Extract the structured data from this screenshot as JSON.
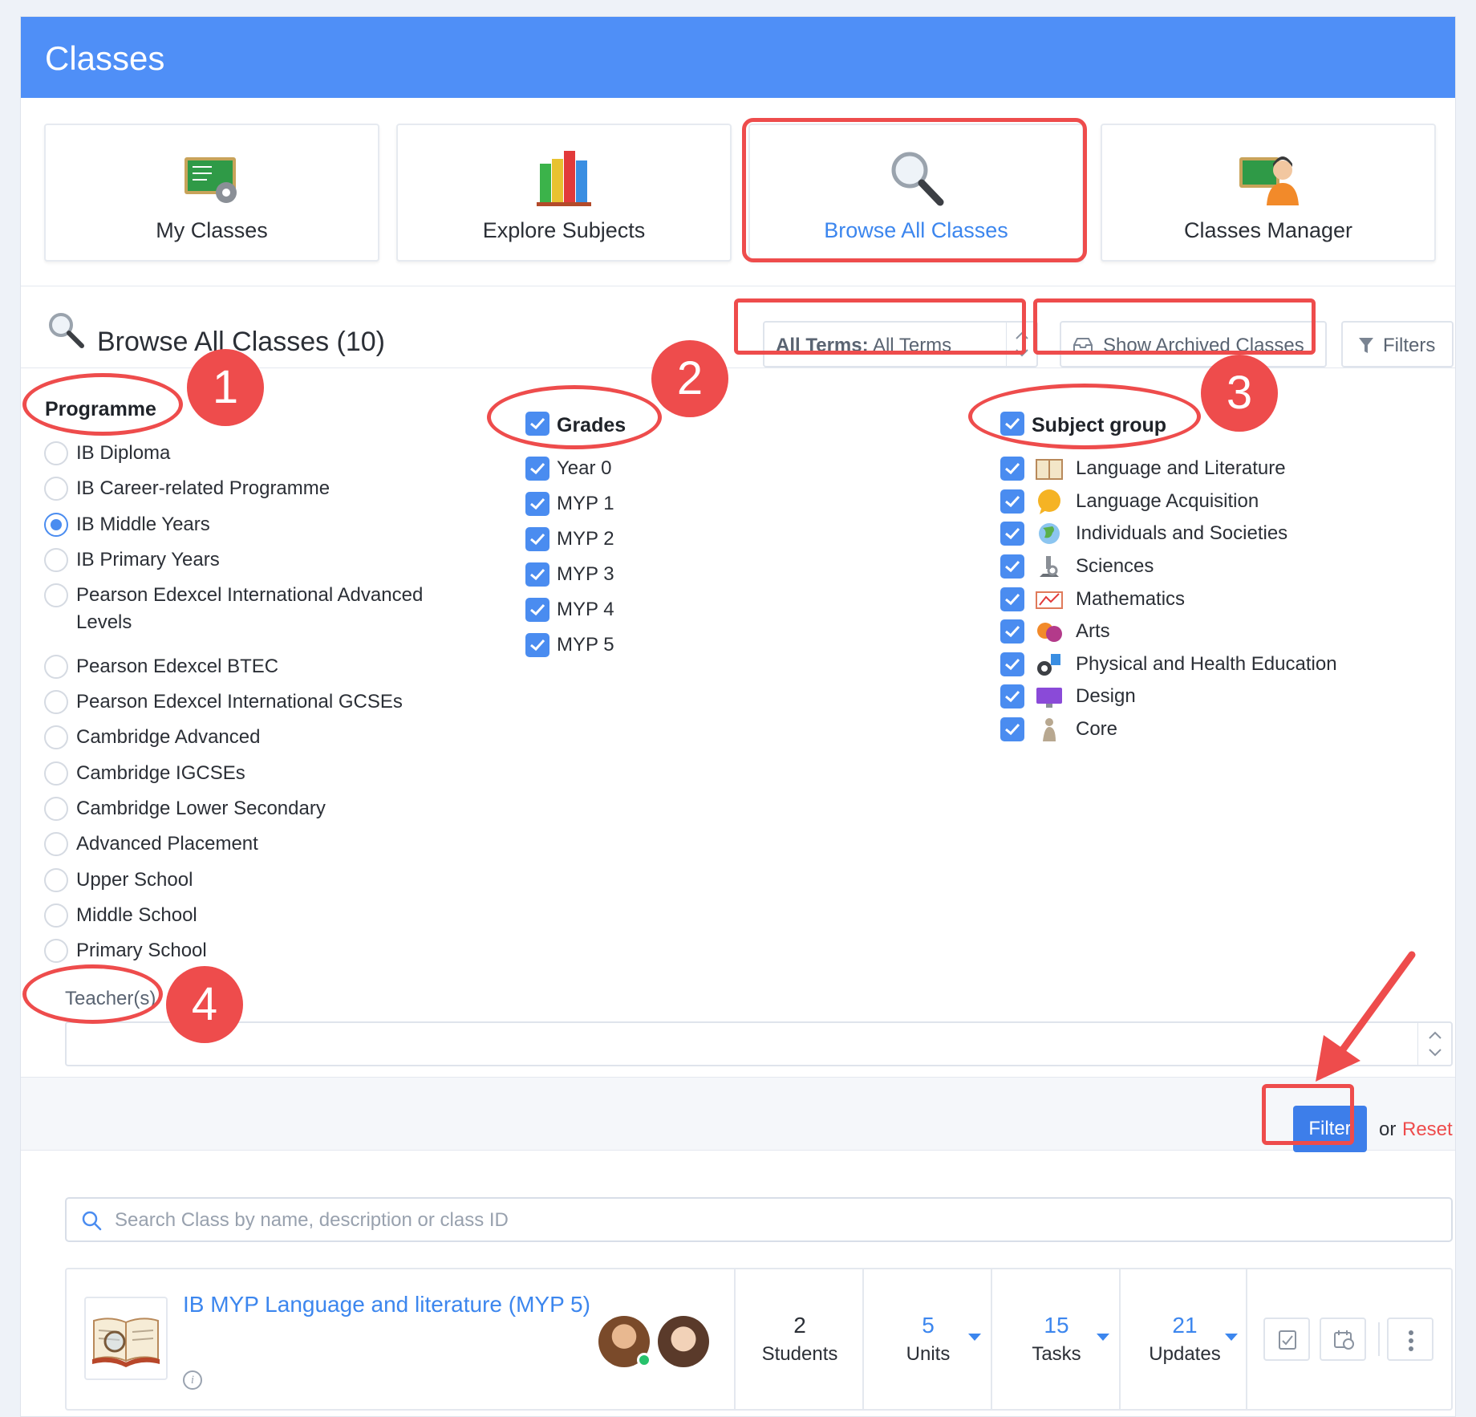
{
  "header": {
    "title": "Classes"
  },
  "cards": [
    {
      "label": "My Classes",
      "icon": "chalkboard-gear-icon"
    },
    {
      "label": "Explore Subjects",
      "icon": "books-icon"
    },
    {
      "label": "Browse All Classes",
      "icon": "magnifier-icon"
    },
    {
      "label": "Classes Manager",
      "icon": "chalkboard-teacher-icon"
    }
  ],
  "toolbar": {
    "title": "Browse All Classes (10)",
    "term_label": "All Terms:",
    "term_value": "All Terms",
    "archived_label": "Show Archived Classes",
    "filters_label": "Filters"
  },
  "annotations": [
    "1",
    "2",
    "3",
    "4"
  ],
  "programme": {
    "heading": "Programme",
    "options": [
      "IB Diploma",
      "IB Career-related Programme",
      "IB Middle Years",
      "IB Primary Years",
      "Pearson Edexcel International Advanced Levels",
      "Pearson Edexcel BTEC",
      "Pearson Edexcel International GCSEs",
      "Cambridge Advanced",
      "Cambridge IGCSEs",
      "Cambridge Lower Secondary",
      "Advanced Placement",
      "Upper School",
      "Middle School",
      "Primary School"
    ],
    "selected": "IB Middle Years"
  },
  "grades": {
    "heading": "Grades",
    "options": [
      "Year 0",
      "MYP 1",
      "MYP 2",
      "MYP 3",
      "MYP 4",
      "MYP 5"
    ]
  },
  "subject_group": {
    "heading": "Subject group",
    "options": [
      "Language and Literature",
      "Language Acquisition",
      "Individuals and Societies",
      "Sciences",
      "Mathematics",
      "Arts",
      "Physical and Health Education",
      "Design",
      "Core"
    ]
  },
  "teachers": {
    "label": "Teacher(s)"
  },
  "filter_actions": {
    "filter_label": "Filter",
    "or": "or",
    "reset_label": "Reset"
  },
  "search": {
    "placeholder": "Search Class by name, description or class ID"
  },
  "class_item": {
    "title": "IB MYP Language and literature (MYP 5)",
    "stats": [
      {
        "value": "2",
        "label": "Students"
      },
      {
        "value": "5",
        "label": "Units"
      },
      {
        "value": "15",
        "label": "Tasks"
      },
      {
        "value": "21",
        "label": "Updates"
      }
    ]
  },
  "colors": {
    "header": "#4f8ff7",
    "accent": "#3c86ee",
    "highlight": "#ee4c4c"
  }
}
